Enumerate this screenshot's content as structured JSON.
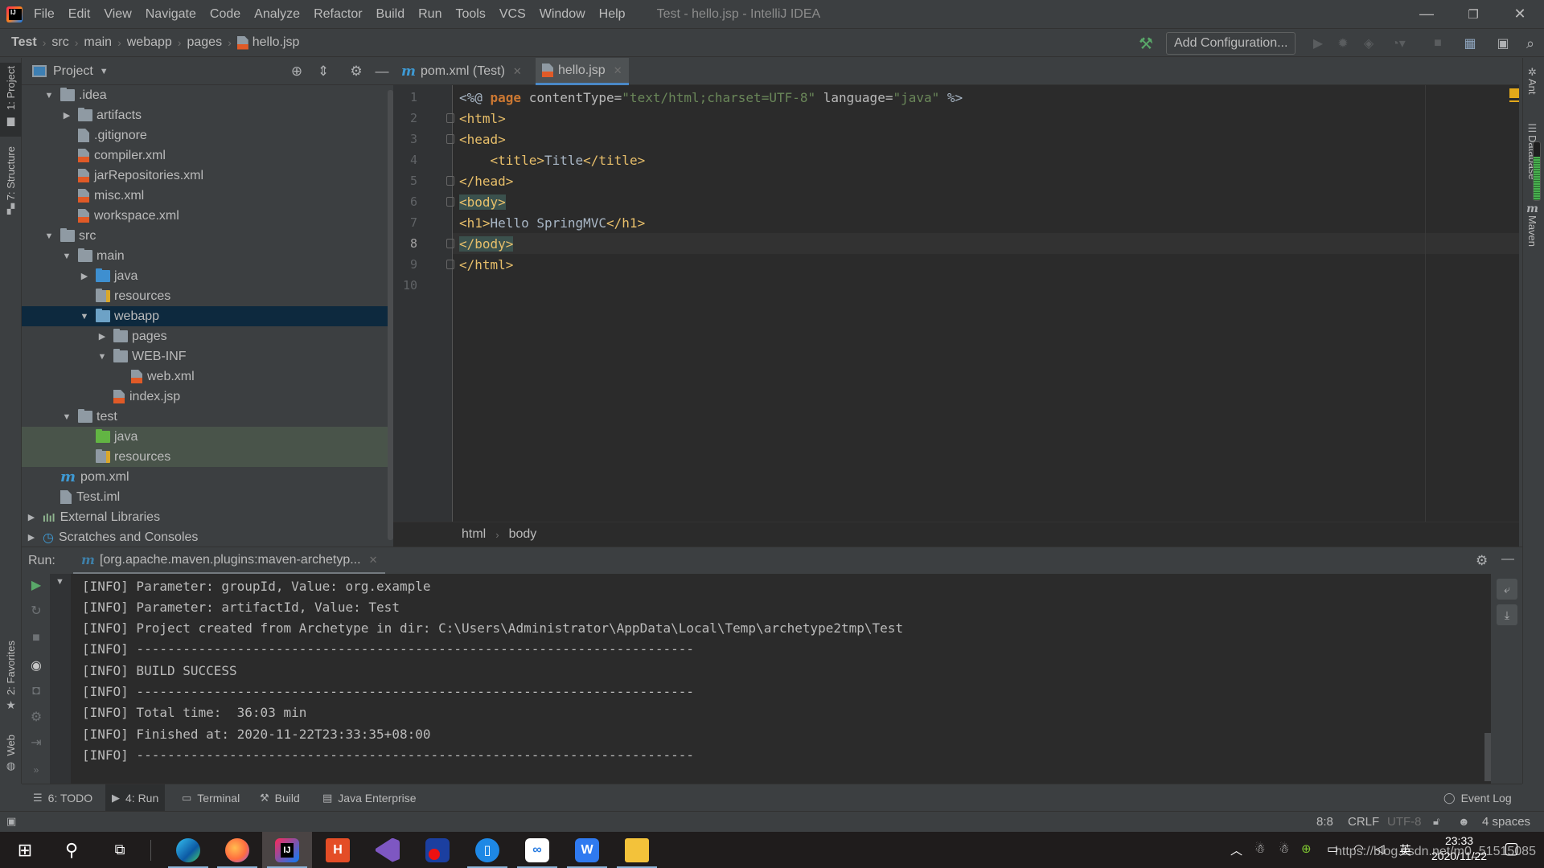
{
  "window": {
    "title": "Test - hello.jsp - IntelliJ IDEA",
    "menu": [
      "File",
      "Edit",
      "View",
      "Navigate",
      "Code",
      "Analyze",
      "Refactor",
      "Build",
      "Run",
      "Tools",
      "VCS",
      "Window",
      "Help"
    ],
    "minimize": "—",
    "restore": "❐",
    "close": "✕"
  },
  "navbar": {
    "breadcrumbs": [
      "Test",
      "src",
      "main",
      "webapp",
      "pages",
      "hello.jsp"
    ],
    "add_configuration": "Add Configuration..."
  },
  "left_strip": {
    "tabs": [
      "1: Project",
      "7: Structure",
      "2: Favorites",
      "Web"
    ]
  },
  "right_strip": {
    "tabs": [
      "Ant",
      "Database",
      "Maven"
    ],
    "memory_usage_fraction": 0.75
  },
  "project_panel": {
    "title": "Project",
    "tree": [
      {
        "label": ".idea",
        "depth": 1,
        "expander": "open",
        "icon": "folder"
      },
      {
        "label": "artifacts",
        "depth": 2,
        "expander": "closed",
        "icon": "folder"
      },
      {
        "label": ".gitignore",
        "depth": 2,
        "expander": "none",
        "icon": "ignore-file"
      },
      {
        "label": "compiler.xml",
        "depth": 2,
        "expander": "none",
        "icon": "xml-file"
      },
      {
        "label": "jarRepositories.xml",
        "depth": 2,
        "expander": "none",
        "icon": "xml-file"
      },
      {
        "label": "misc.xml",
        "depth": 2,
        "expander": "none",
        "icon": "xml-file"
      },
      {
        "label": "workspace.xml",
        "depth": 2,
        "expander": "none",
        "icon": "xml-file"
      },
      {
        "label": "src",
        "depth": 1,
        "expander": "open",
        "icon": "folder"
      },
      {
        "label": "main",
        "depth": 2,
        "expander": "open",
        "icon": "folder"
      },
      {
        "label": "java",
        "depth": 3,
        "expander": "closed",
        "icon": "source-folder"
      },
      {
        "label": "resources",
        "depth": 3,
        "expander": "none",
        "icon": "resources-folder"
      },
      {
        "label": "webapp",
        "depth": 3,
        "expander": "open",
        "icon": "web-folder",
        "selected": true
      },
      {
        "label": "pages",
        "depth": 4,
        "expander": "closed",
        "icon": "folder"
      },
      {
        "label": "WEB-INF",
        "depth": 4,
        "expander": "open",
        "icon": "folder"
      },
      {
        "label": "web.xml",
        "depth": 5,
        "expander": "none",
        "icon": "xml-file"
      },
      {
        "label": "index.jsp",
        "depth": 4,
        "expander": "none",
        "icon": "jsp-file"
      },
      {
        "label": "test",
        "depth": 2,
        "expander": "open",
        "icon": "folder"
      },
      {
        "label": "java",
        "depth": 3,
        "expander": "none",
        "icon": "test-folder",
        "test": true
      },
      {
        "label": "resources",
        "depth": 3,
        "expander": "none",
        "icon": "test-resources-folder",
        "test": true
      },
      {
        "label": "pom.xml",
        "depth": 1,
        "expander": "none",
        "icon": "maven-file"
      },
      {
        "label": "Test.iml",
        "depth": 1,
        "expander": "none",
        "icon": "iml-file"
      },
      {
        "label": "External Libraries",
        "depth": 0,
        "expander": "closed",
        "icon": "libraries"
      },
      {
        "label": "Scratches and Consoles",
        "depth": 0,
        "expander": "closed",
        "icon": "scratches"
      }
    ]
  },
  "editor": {
    "tabs": [
      {
        "label": "pom.xml (Test)",
        "icon": "maven-icon",
        "active": false
      },
      {
        "label": "hello.jsp",
        "icon": "jsp-file-icon",
        "active": true
      }
    ],
    "current_line": 8,
    "lines": [
      "<%@ page contentType=\"text/html;charset=UTF-8\" language=\"java\" %>",
      "<html>",
      "<head>",
      "    <title>Title</title>",
      "</head>",
      "<body>",
      "<h1>Hello SpringMVC</h1>",
      "</body>",
      "</html>",
      ""
    ],
    "tokens": {
      "l1": [
        "<%@ ",
        "page",
        " contentType=",
        "\"text/html;charset=UTF-8\"",
        " language=",
        "\"java\"",
        " %>"
      ],
      "l2": "<html>",
      "l3": "<head>",
      "l4": "<title>Title</title>",
      "l5": "</head>",
      "l6": "<body>",
      "l7": "<h1>Hello SpringMVC</h1>",
      "l8": "</body>",
      "l9": "</html>"
    },
    "breadcrumbs": [
      "html",
      "body"
    ]
  },
  "run_panel": {
    "label": "Run:",
    "tab": "[org.apache.maven.plugins:maven-archetyp...",
    "console": [
      "[INFO] Parameter: groupId, Value: org.example",
      "[INFO] Parameter: artifactId, Value: Test",
      "[INFO] Project created from Archetype in dir: C:\\Users\\Administrator\\AppData\\Local\\Temp\\archetype2tmp\\Test",
      "[INFO] ------------------------------------------------------------------------",
      "[INFO] BUILD SUCCESS",
      "[INFO] ------------------------------------------------------------------------",
      "[INFO] Total time:  36:03 min",
      "[INFO] Finished at: 2020-11-22T23:33:35+08:00",
      "[INFO] ------------------------------------------------------------------------"
    ]
  },
  "tool_tabs": [
    {
      "label": "6: TODO",
      "icon": "todo-icon"
    },
    {
      "label": "4: Run",
      "icon": "run-icon",
      "active": true
    },
    {
      "label": "Terminal",
      "icon": "terminal-icon"
    },
    {
      "label": "Build",
      "icon": "build-icon"
    },
    {
      "label": "Java Enterprise",
      "icon": "java-enterprise-icon"
    }
  ],
  "event_log": "Event Log",
  "status_bar": {
    "position": "8:8",
    "line_separator": "CRLF",
    "encoding": "UTF-8",
    "indent": "4 spaces"
  },
  "taskbar": {
    "apps": [
      "Start",
      "Search",
      "Task View",
      "Edge",
      "Firefox",
      "IntelliJ IDEA",
      "HBuilder",
      "Visual Studio",
      "App",
      "Phone",
      "Baidu Netdisk",
      "WPS",
      "File Explorer"
    ],
    "time": "23:33",
    "date": "2020/11/22",
    "ime": "英",
    "watermark": "https://blog.csdn.net/m0_51515085"
  }
}
